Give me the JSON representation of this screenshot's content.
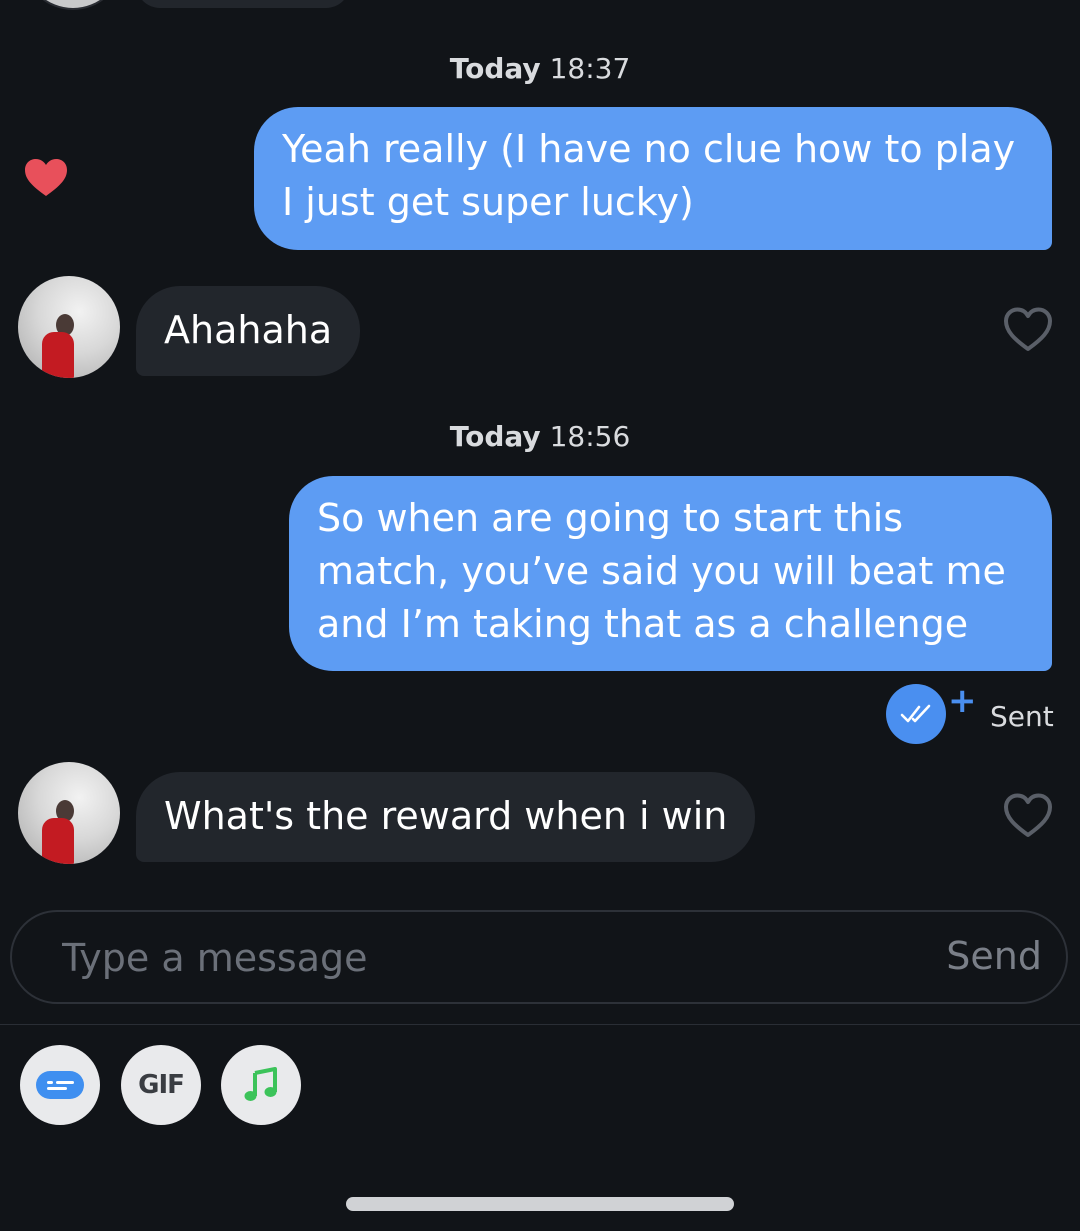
{
  "conversation": {
    "groups": [
      {
        "timestamp_day": "Today",
        "timestamp_time": "18:37",
        "outgoing_text": "Yeah really (I have no clue how to play I just get super lucky)",
        "incoming_text": "Ahahaha"
      },
      {
        "timestamp_day": "Today",
        "timestamp_time": "18:56",
        "outgoing_text": "So when are going to start this match, you’ve said you will beat me and I’m taking that as a challenge",
        "incoming_text": "What's the reward when i win"
      }
    ],
    "status_label": "Sent"
  },
  "composer": {
    "placeholder": "Type a message",
    "send_label": "Send"
  },
  "toolbar": {
    "gif_label": "GIF",
    "icons": [
      "sticker-card-icon",
      "gif-icon",
      "music-note-icon"
    ]
  },
  "colors": {
    "outgoing_bubble": "#5d9cf3",
    "incoming_bubble": "#22262c",
    "accent": "#4a8ff0",
    "like_heart": "#e8505b",
    "music_green": "#3cc35a"
  }
}
